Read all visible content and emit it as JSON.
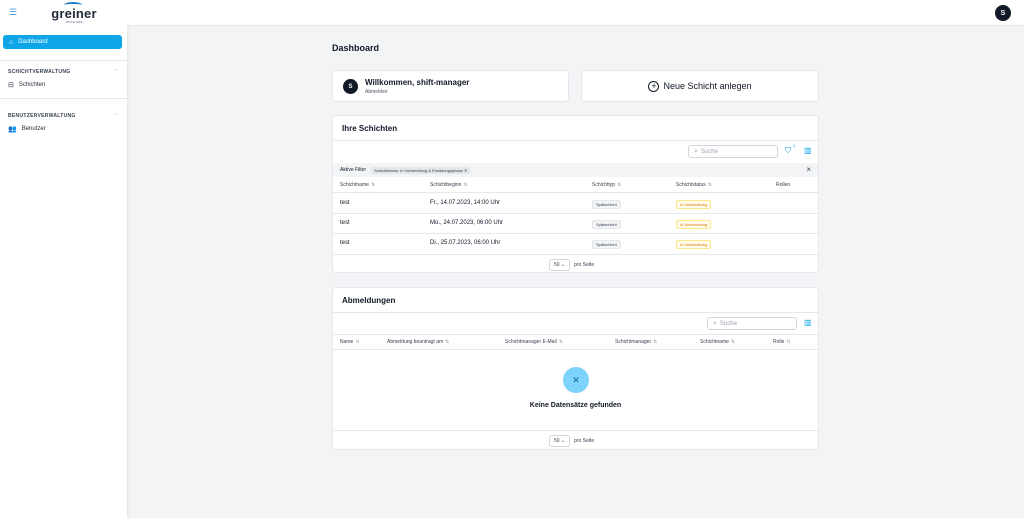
{
  "sidebar": {
    "logo_text": "greiner",
    "logo_sub": "SINCE 1868",
    "dashboard_label": "Dashboard",
    "section1": "SCHICHTVERWALTUNG",
    "shifts_label": "Schichten",
    "section2": "BENUTZERVERWALTUNG",
    "users_label": "Benutzer",
    "menu_icon": "hamburger-icon"
  },
  "header": {
    "avatar": "S"
  },
  "page_title": "Dashboard",
  "welcome": {
    "avatar": "S",
    "title": "Willkommen, shift-manager",
    "subtitle": "Abmelden"
  },
  "new_shift": {
    "label": "Neue Schicht anlegen"
  },
  "shifts": {
    "title": "Ihre Schichten",
    "search_placeholder": "Suche",
    "filter_count": "1",
    "active_filter_label": "Aktive Filter",
    "filter_chip": "Schichtstatus: In Vorbereitung & Einladungsphase",
    "columns": [
      "Schichtname",
      "Schichtbeginn",
      "Schichttyp",
      "Schichtstatus",
      "Rollen"
    ],
    "rows": [
      {
        "name": "test",
        "start": "Fr., 14.07.2023, 14:00 Uhr",
        "type": "Spätschicht",
        "status": "In Vorbereitung"
      },
      {
        "name": "test",
        "start": "Mo., 24.07.2023, 06:00 Uhr",
        "type": "Spätschicht",
        "status": "In Vorbereitung"
      },
      {
        "name": "test",
        "start": "Di., 25.07.2023, 06:00 Uhr",
        "type": "Spätschicht",
        "status": "In Vorbereitung"
      }
    ],
    "page_size": "50",
    "per_page": "pro Seite"
  },
  "abmeldungen": {
    "title": "Abmeldungen",
    "search_placeholder": "Suche",
    "columns": [
      "Name",
      "Abmeldung beantragt am",
      "Schichtmanager E-Mail",
      "Schichtmanager",
      "Schichtname",
      "Rolle"
    ],
    "empty_text": "Keine Datensätze gefunden",
    "page_size": "50",
    "per_page": "pro Seite"
  },
  "colors": {
    "accent": "#0ea5e9",
    "warning": "#d97706"
  }
}
